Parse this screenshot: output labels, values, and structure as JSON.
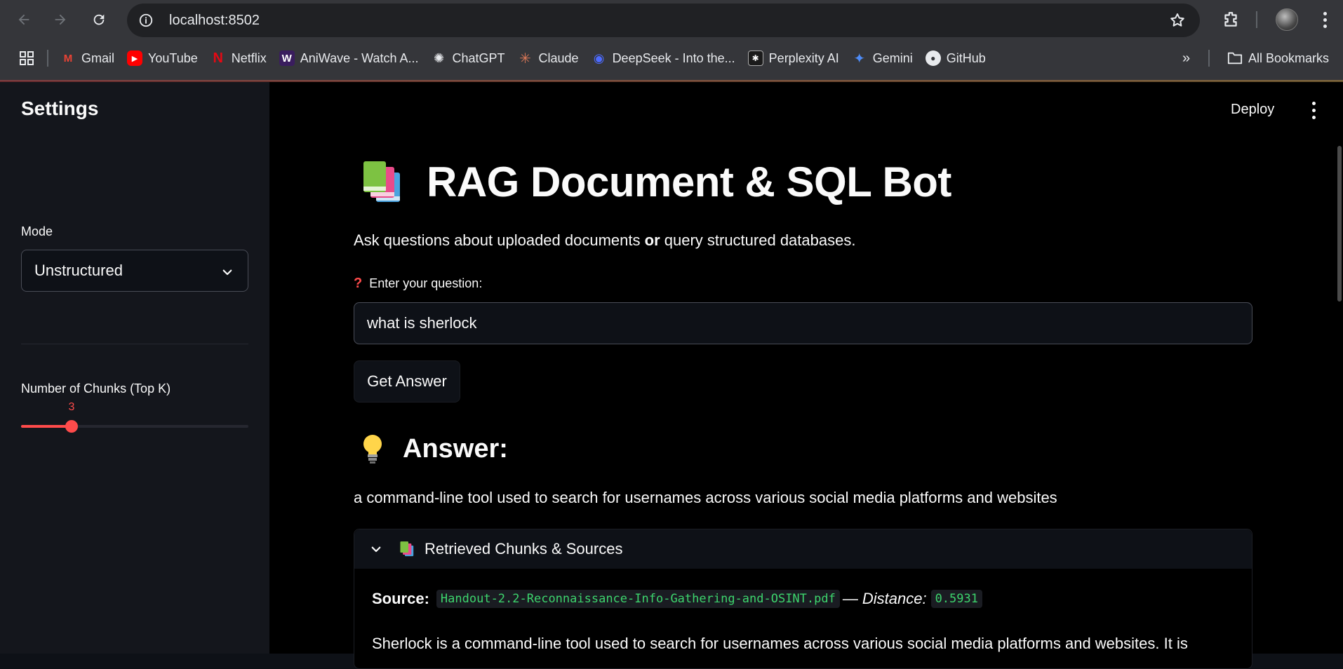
{
  "browser": {
    "url": "localhost:8502",
    "bookmarks": [
      {
        "label": "Gmail",
        "icon": "gmail-icon"
      },
      {
        "label": "YouTube",
        "icon": "youtube-icon"
      },
      {
        "label": "Netflix",
        "icon": "netflix-icon"
      },
      {
        "label": "AniWave - Watch A...",
        "icon": "aniwave-icon"
      },
      {
        "label": "ChatGPT",
        "icon": "chatgpt-icon"
      },
      {
        "label": "Claude",
        "icon": "claude-icon"
      },
      {
        "label": "DeepSeek - Into the...",
        "icon": "deepseek-icon"
      },
      {
        "label": "Perplexity AI",
        "icon": "perplexity-icon"
      },
      {
        "label": "Gemini",
        "icon": "gemini-icon"
      },
      {
        "label": "GitHub",
        "icon": "github-icon"
      }
    ],
    "all_bookmarks": "All Bookmarks"
  },
  "sidebar": {
    "title": "Settings",
    "mode_label": "Mode",
    "mode_value": "Unstructured",
    "topk_label": "Number of Chunks (Top K)",
    "topk_value": "3",
    "topk_fraction": 0.2222
  },
  "header": {
    "deploy_label": "Deploy"
  },
  "main": {
    "title": "RAG Document & SQL Bot",
    "subtitle_pre": "Ask questions about uploaded documents ",
    "subtitle_bold": "or",
    "subtitle_post": " query structured databases.",
    "question_label": "Enter your question:",
    "question_value": "what is sherlock",
    "button_label": "Get Answer",
    "answer_heading": "Answer:",
    "answer_text": "a command-line tool used to search for usernames across various social media platforms and websites",
    "expander_title": "Retrieved Chunks & Sources",
    "source_label": "Source:",
    "source_file": "Handout-2.2-Reconnaissance-Info-Gathering-and-OSINT.pdf",
    "dash": "—",
    "distance_label": "Distance:",
    "distance_value": "0.5931",
    "chunk_text": "Sherlock is a command-line tool used to search for usernames across various social media platforms and websites. It is"
  },
  "colors": {
    "accent": "#ff4b4b",
    "code_green": "#3dd56d",
    "sidebar_bg": "#14161c",
    "main_bg": "#000000"
  }
}
